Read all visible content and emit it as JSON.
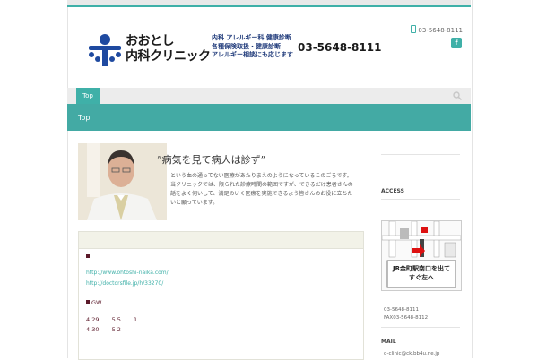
{
  "header": {
    "logo_name_line1": "おおとし",
    "logo_name_line2": "内科クリニック",
    "services": [
      "内科 アレルギー科 健康診断",
      "各種保険取扱・健康診断",
      "アレルギー相談にも応じます"
    ],
    "big_phone": "03-5648-8111",
    "top_phone": "03-5648-8111",
    "facebook_label": "f"
  },
  "nav": {
    "items": [
      {
        "label": "Top"
      }
    ]
  },
  "banner": {
    "title": "Top"
  },
  "hero": {
    "quote": "”病気を見て病人は診ず”",
    "intro": "という血の通ってない医療があたりまえのようになっているこのごろです。当クリニックでは、限られた診療時間の範囲ですが、できるだけ患者さんの話をよく伺いして、満足のいく医療を実施できるよう皆さんのお役に立ちたいと願っています。"
  },
  "content": {
    "link1": "http://www.ohtoshi-naika.com/",
    "link2": "http://doctorsfile.jp/h/33270/",
    "gw_label": "GW",
    "row1": [
      "4 29",
      "5 5",
      "1"
    ],
    "row2": [
      "4 30",
      "5 2"
    ]
  },
  "sidebar": {
    "access_heading": "ACCESS",
    "map_sign": "JR金町駅南口を出てすぐ左へ",
    "phone": "03-5648-8111",
    "fax": "FAX03-5648-8112",
    "mail_heading": "MAIL",
    "mail": "o-clinic@ck.bb4u.ne.jp"
  },
  "colors": {
    "accent": "#3fb0a8",
    "banner": "#43aaa4",
    "brand_blue": "#1f4aa0",
    "bullet": "#5b1a2a"
  }
}
